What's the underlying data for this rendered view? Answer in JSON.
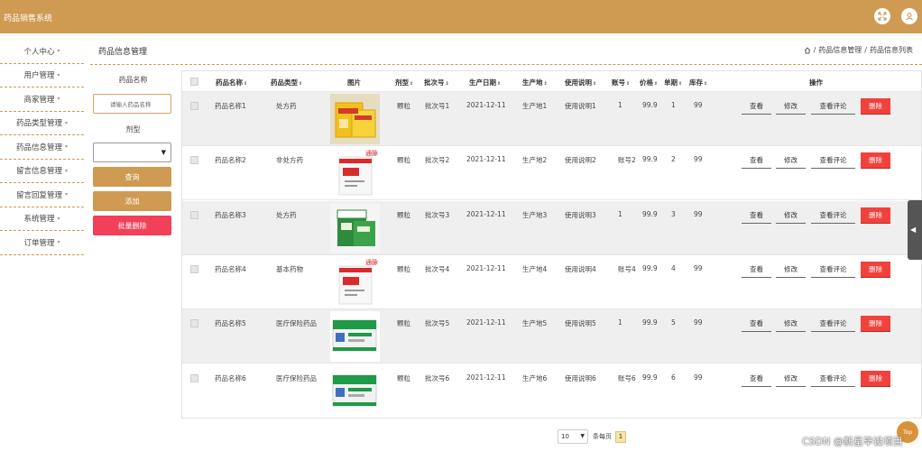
{
  "app": {
    "title": "药品销售系统",
    "accent": "#cf9a52",
    "header_icons": [
      "fullscreen-icon",
      "user-icon"
    ]
  },
  "sidebar": {
    "items": [
      {
        "label": "个人中心"
      },
      {
        "label": "用户管理"
      },
      {
        "label": "商家管理"
      },
      {
        "label": "药品类型管理"
      },
      {
        "label": "药品信息管理"
      },
      {
        "label": "留言信息管理"
      },
      {
        "label": "留言回复管理"
      },
      {
        "label": "系统管理"
      },
      {
        "label": "订单管理"
      }
    ],
    "caret": "▾"
  },
  "page": {
    "title": "药品信息管理",
    "breadcrumb": [
      "药品信息管理",
      "药品信息列表"
    ],
    "separator": "/"
  },
  "filter": {
    "name_label": "药品名称",
    "name_placeholder": "请输入药品名称",
    "form_label": "剂型",
    "form_value": "",
    "query_button": "查询",
    "add_button": "添加",
    "bulk_delete_button": "批量删除"
  },
  "table": {
    "headers": [
      "药品名称",
      "药品类型",
      "图片",
      "剂型",
      "批次号",
      "生产日期",
      "生产地",
      "使用说明",
      "账号",
      "价格",
      "单期",
      "库存",
      "操作"
    ],
    "sort_glyph": "⇕",
    "rows": [
      {
        "name": "药品名称1",
        "type": "处方药",
        "image": "yellow-medicine-box",
        "form": "颗粒",
        "batch": "批次号1",
        "date": "2021-12-11",
        "origin": "生产地1",
        "usage": "使用说明1",
        "account": "1",
        "price": "99.9",
        "period": "1",
        "stock": "99"
      },
      {
        "name": "药品名称2",
        "type": "非处方药",
        "image": "white-red-medicine-box",
        "form": "颗粒",
        "batch": "批次号2",
        "date": "2021-12-11",
        "origin": "生产地2",
        "usage": "使用说明2",
        "account": "账号2",
        "price": "99.9",
        "period": "2",
        "stock": "99"
      },
      {
        "name": "药品名称3",
        "type": "处方药",
        "image": "green-medicine-box",
        "form": "颗粒",
        "batch": "批次号3",
        "date": "2021-12-11",
        "origin": "生产地3",
        "usage": "使用说明3",
        "account": "1",
        "price": "99.9",
        "period": "3",
        "stock": "99"
      },
      {
        "name": "药品名称4",
        "type": "基本药物",
        "image": "white-red-medicine-box",
        "form": "颗粒",
        "batch": "批次号4",
        "date": "2021-12-11",
        "origin": "生产地4",
        "usage": "使用说明4",
        "account": "账号4",
        "price": "99.9",
        "period": "4",
        "stock": "99"
      },
      {
        "name": "药品名称5",
        "type": "医疗保险药品",
        "image": "green-white-medicine-box",
        "form": "颗粒",
        "batch": "批次号5",
        "date": "2021-12-11",
        "origin": "生产地5",
        "usage": "使用说明5",
        "account": "1",
        "price": "99.9",
        "period": "5",
        "stock": "99"
      },
      {
        "name": "药品名称6",
        "type": "医疗保险药品",
        "image": "green-white-medicine-box",
        "form": "颗粒",
        "batch": "批次号6",
        "date": "2021-12-11",
        "origin": "生产地6",
        "usage": "使用说明6",
        "account": "账号6",
        "price": "99.9",
        "period": "6",
        "stock": "99"
      }
    ],
    "actions": {
      "view": "查看",
      "edit": "修改",
      "reviews": "查看评论",
      "delete": "删除"
    }
  },
  "pagination": {
    "page_size": "10",
    "page_size_label": "条每页",
    "current_page": "1"
  },
  "floating": {
    "top_button": "Top",
    "side_tab_arrow": "◀"
  },
  "watermark": "CSDN @新星毕设项目"
}
